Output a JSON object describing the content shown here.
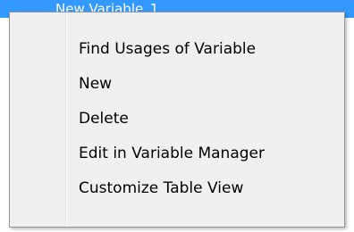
{
  "background_row": {
    "label": "New Variable_1"
  },
  "context_menu": {
    "items": [
      {
        "label": "Find Usages of Variable"
      },
      {
        "label": "New"
      },
      {
        "label": "Delete"
      },
      {
        "label": "Edit in Variable Manager"
      },
      {
        "label": "Customize Table View"
      }
    ]
  },
  "colors": {
    "selection": "#3399ff",
    "menu_background": "#f0f0f0",
    "menu_border": "#979797"
  }
}
